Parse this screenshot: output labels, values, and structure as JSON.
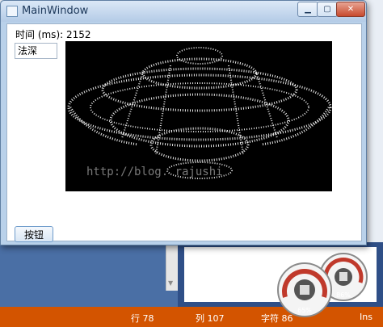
{
  "window": {
    "title": "MainWindow"
  },
  "main": {
    "time_label": "时间 (ms): 2152",
    "depth_value": "法深",
    "button_label": "按钮",
    "watermark": "http://blog.            rajushi"
  },
  "statusbar": {
    "line": "行 78",
    "column": "列 107",
    "char": "字符 86",
    "mode": "Ins"
  },
  "gauges": {
    "cpu_percent": "65%",
    "mem_percent": "86%"
  },
  "colors": {
    "statusbar": "#d35400",
    "window_frame": "#b9d1ea"
  }
}
